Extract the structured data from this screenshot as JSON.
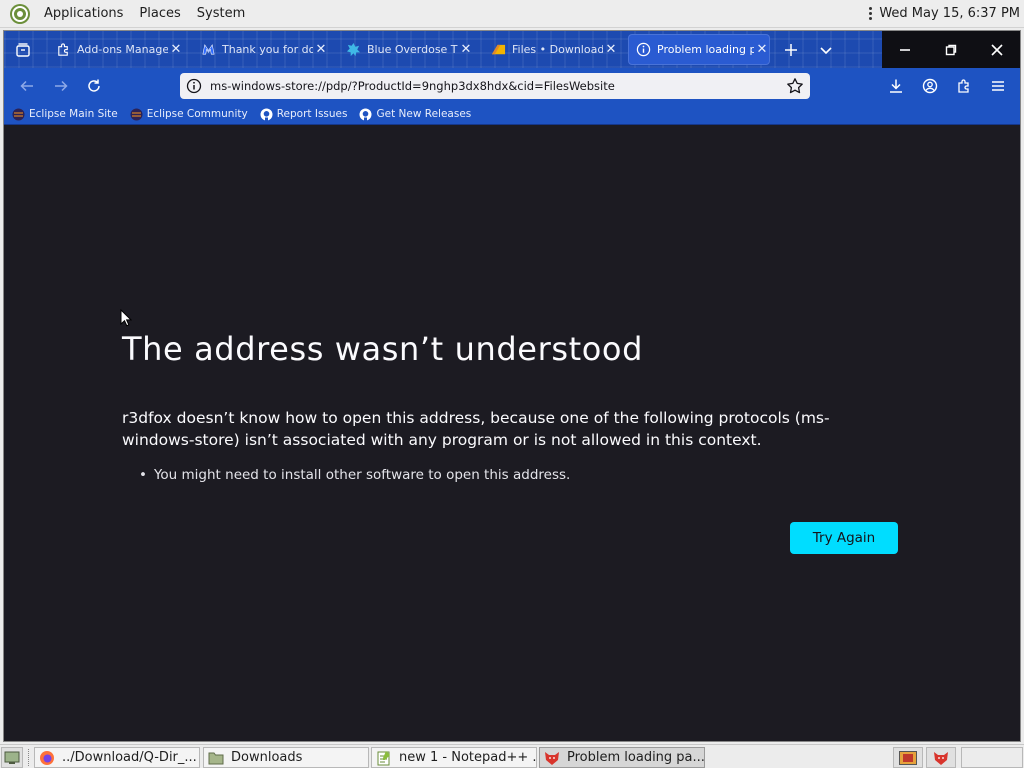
{
  "top_panel": {
    "menus": [
      "Applications",
      "Places",
      "System"
    ],
    "clock": "Wed May 15,  6:37 PM"
  },
  "tabs": [
    {
      "label": "Add-ons Manager",
      "icon": "puzzle-icon"
    },
    {
      "label": "Thank you for dow",
      "icon": "malwarebytes-icon"
    },
    {
      "label": "Blue Overdose Th",
      "icon": "blue-overdose-icon"
    },
    {
      "label": "Files • Download",
      "icon": "files-icon"
    },
    {
      "label": "Problem loading pa",
      "icon": "info-icon",
      "active": true
    }
  ],
  "toolbar": {
    "url": "ms-windows-store://pdp/?ProductId=9nghp3dx8hdx&cid=FilesWebsite"
  },
  "bookmarks": [
    "Eclipse Main Site",
    "Eclipse Community",
    "Report Issues",
    "Get New Releases"
  ],
  "error_page": {
    "title": "The address wasn’t understood",
    "description": "r3dfox doesn’t know how to open this address, because one of the following protocols (ms-windows-store) isn’t associated with any program or is not allowed in this context.",
    "bullet": "You might need to install other software to open this address.",
    "button": "Try Again"
  },
  "taskbar": {
    "items": [
      {
        "label": "../Download/Q-Dir_...",
        "icon": "firefox-icon"
      },
      {
        "label": "Downloads",
        "icon": "folder-icon"
      },
      {
        "label": "new 1 - Notepad++ ...",
        "icon": "notepad-icon"
      },
      {
        "label": "Problem loading pa...",
        "icon": "r3dfox-icon",
        "active": true
      }
    ]
  },
  "colors": {
    "tab_bar": "#1d4ab0",
    "nav_bar": "#1e53c2",
    "content_bg": "#1c1b22",
    "button_accent": "#00ddff"
  }
}
